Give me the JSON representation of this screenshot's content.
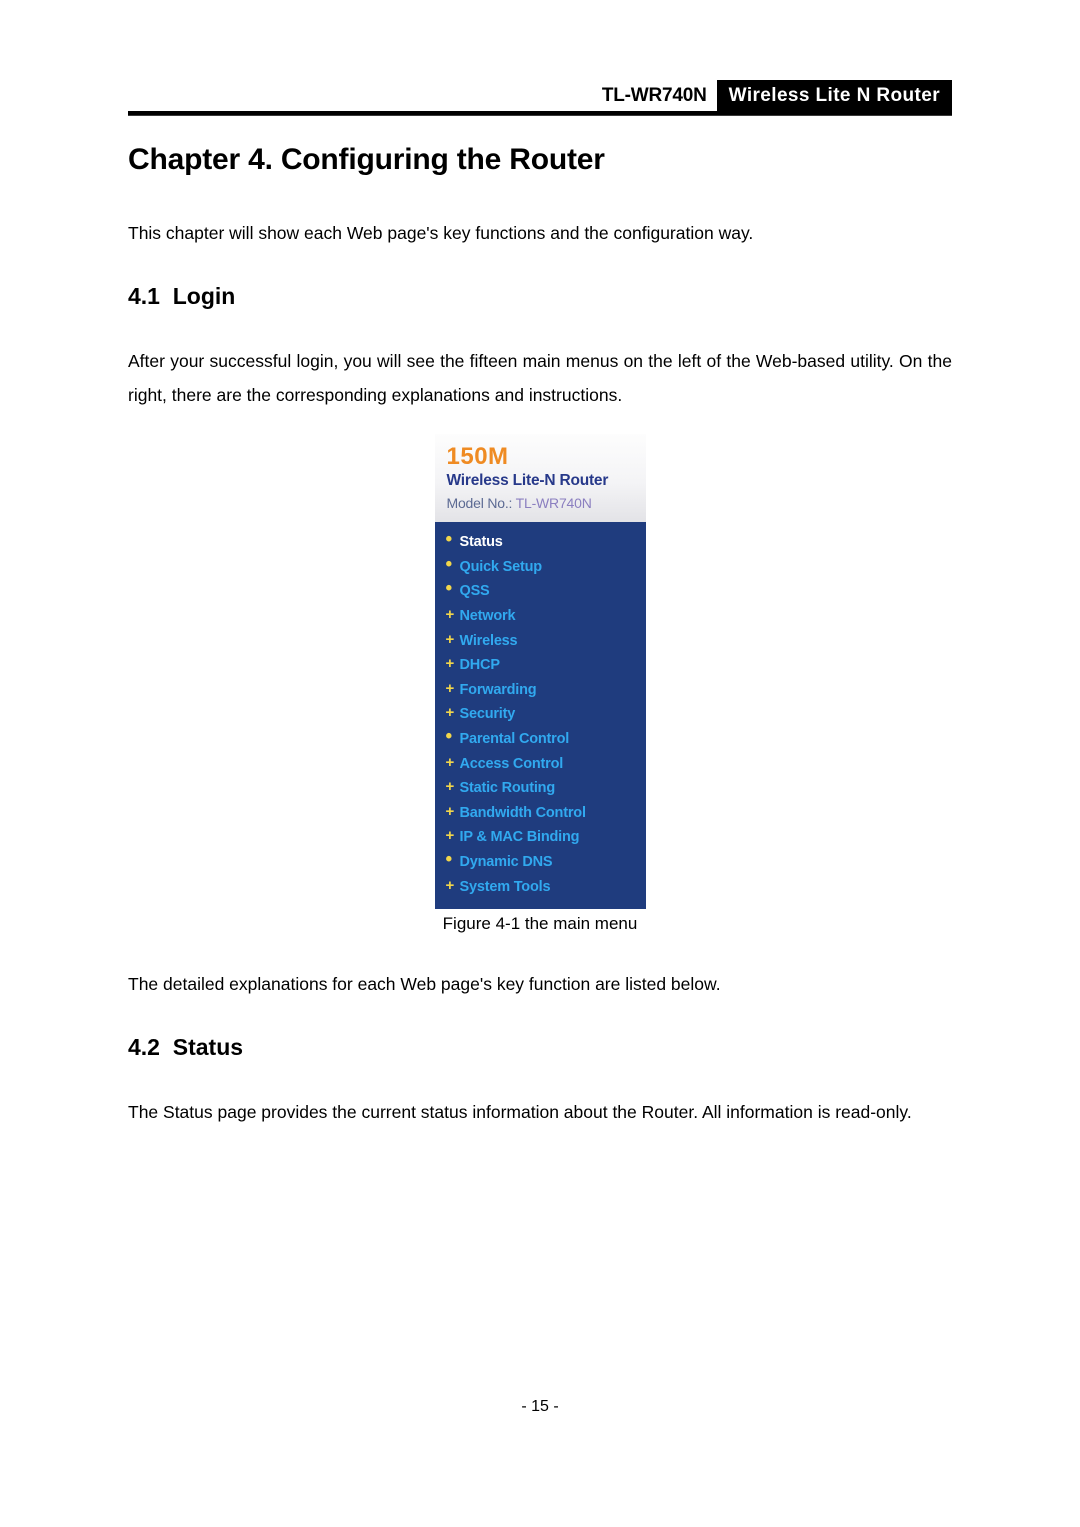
{
  "header": {
    "model": "TL-WR740N",
    "tagline": "Wireless  Lite  N  Router"
  },
  "content": {
    "chapter_title": "Chapter 4. Configuring the Router",
    "chapter_intro": "This chapter will show each Web page's key functions and the configuration way.",
    "section_login": {
      "title": "4.1  Login",
      "paragraph": "After your successful login, you will see the fifteen main menus on the left of the Web-based utility. On the right, there are the corresponding explanations and instructions."
    },
    "figure": {
      "caption": "Figure 4-1 the main menu",
      "panel": {
        "speed": "150M",
        "product_name": "Wireless Lite-N Router",
        "model_label": "Model No.:",
        "model_value": "TL-WR740N",
        "menu_items": [
          {
            "label": "Status",
            "bullet": "dot",
            "active": true
          },
          {
            "label": "Quick Setup",
            "bullet": "dot",
            "active": false
          },
          {
            "label": "QSS",
            "bullet": "dot",
            "active": false
          },
          {
            "label": "Network",
            "bullet": "plus",
            "active": false
          },
          {
            "label": "Wireless",
            "bullet": "plus",
            "active": false
          },
          {
            "label": "DHCP",
            "bullet": "plus",
            "active": false
          },
          {
            "label": "Forwarding",
            "bullet": "plus",
            "active": false
          },
          {
            "label": "Security",
            "bullet": "plus",
            "active": false
          },
          {
            "label": "Parental Control",
            "bullet": "dot",
            "active": false
          },
          {
            "label": "Access Control",
            "bullet": "plus",
            "active": false
          },
          {
            "label": "Static Routing",
            "bullet": "plus",
            "active": false
          },
          {
            "label": "Bandwidth Control",
            "bullet": "plus",
            "active": false
          },
          {
            "label": "IP & MAC Binding",
            "bullet": "plus",
            "active": false
          },
          {
            "label": "Dynamic DNS",
            "bullet": "dot",
            "active": false
          },
          {
            "label": "System Tools",
            "bullet": "plus",
            "active": false
          }
        ],
        "colors": {
          "menu_background": "#1f3c7e",
          "menu_link": "#31a9ef",
          "menu_active": "#ffffff",
          "bullet": "#f2d64b",
          "speed_text": "#ef8b23",
          "product_name": "#27398a",
          "model_value": "#8b7fc0"
        }
      }
    },
    "after_figure": "The detailed explanations for each Web page's key function are listed below.",
    "section_status": {
      "title": "4.2  Status",
      "paragraph": "The Status page provides the current status information about the Router. All information is read-only."
    }
  },
  "footer": {
    "page_number": "- 15 -"
  }
}
